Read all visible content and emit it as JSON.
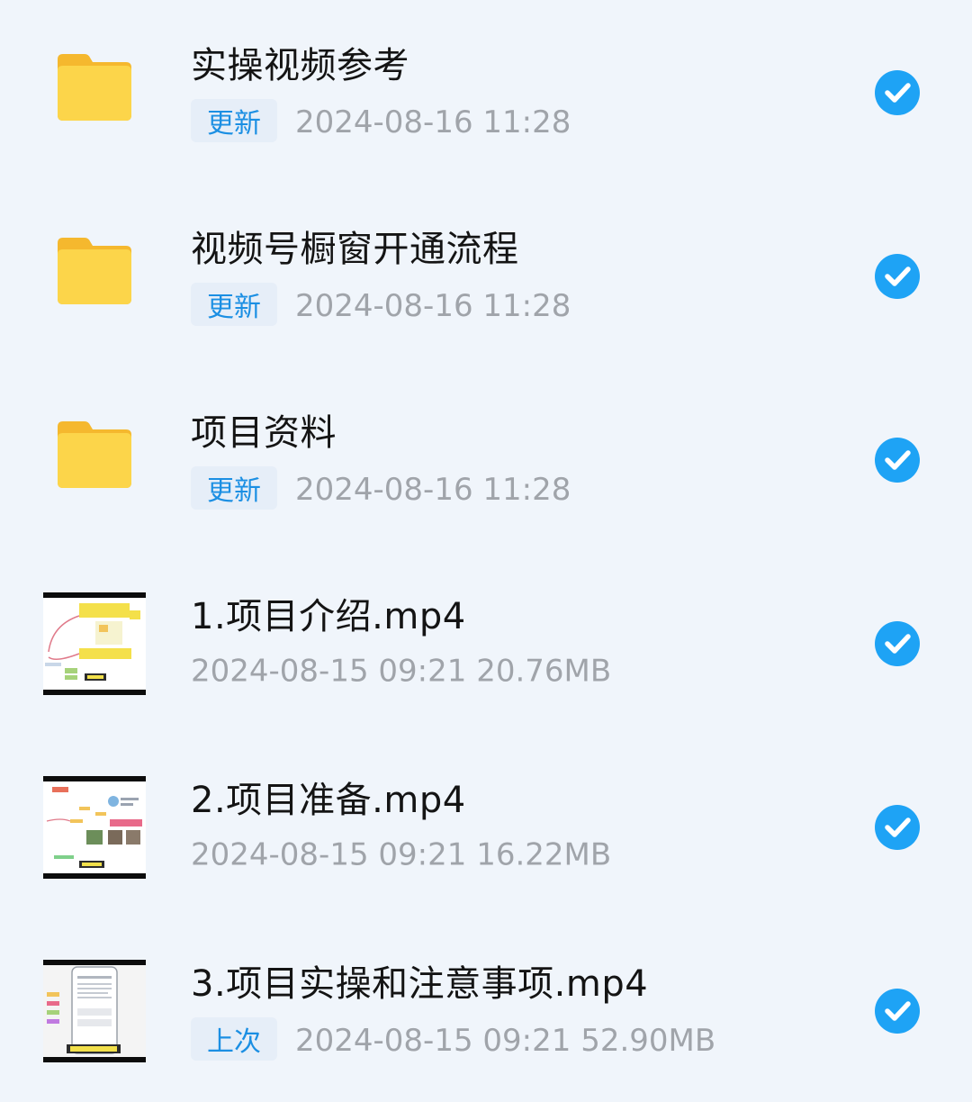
{
  "files": [
    {
      "type": "folder",
      "icon": "folder-icon",
      "name": "实操视频参考",
      "tag": "更新",
      "date": "2024-08-16",
      "time": "11:28",
      "size": "",
      "checked": true
    },
    {
      "type": "folder",
      "icon": "folder-icon",
      "name": "视频号橱窗开通流程",
      "tag": "更新",
      "date": "2024-08-16",
      "time": "11:28",
      "size": "",
      "checked": true
    },
    {
      "type": "folder",
      "icon": "folder-icon",
      "name": "项目资料",
      "tag": "更新",
      "date": "2024-08-16",
      "time": "11:28",
      "size": "",
      "checked": true
    },
    {
      "type": "video",
      "icon": "video-thumbnail",
      "name": "1.项目介绍.mp4",
      "tag": "",
      "date": "2024-08-15",
      "time": "09:21",
      "size": "20.76MB",
      "checked": true
    },
    {
      "type": "video",
      "icon": "video-thumbnail",
      "name": "2.项目准备.mp4",
      "tag": "",
      "date": "2024-08-15",
      "time": "09:21",
      "size": "16.22MB",
      "checked": true
    },
    {
      "type": "video",
      "icon": "video-thumbnail",
      "name": "3.项目实操和注意事项.mp4",
      "tag": "上次",
      "date": "2024-08-15",
      "time": "09:21",
      "size": "52.90MB",
      "checked": true
    }
  ],
  "colors": {
    "background": "#f0f5fb",
    "accent": "#1ea3f5",
    "tag_text": "#1b8fe3",
    "folder": "#fcd34d"
  }
}
